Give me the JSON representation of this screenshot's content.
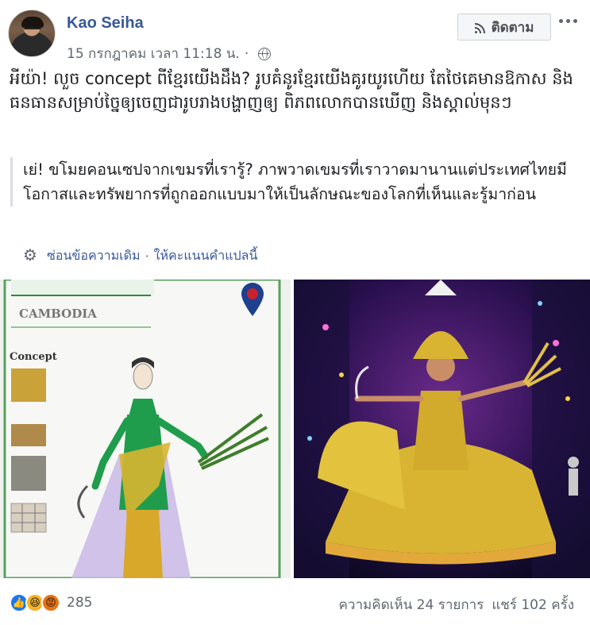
{
  "post": {
    "author": "Kao Seiha",
    "timestamp": "15 กรกฎาคม เวลา 11:18 น.",
    "dot": "·",
    "audience_icon": "globe-icon",
    "follow_label": "ติดตาม",
    "follow_icon": "rss-icon",
    "more_icon": "more-dots-icon",
    "text": "អីយ៉ា! លួច concept ពីខ្មែរយើងដឹង? រូបគំនូរខ្មែរយើងគូរយូរហើយ តែថៃគេមានឱកាស និងធនធានសម្រាប់ច្នៃឲ្យចេញជារូបរាងបង្ហាញឲ្យ ពិភពលោកបានឃើញ និងស្គាល់មុនៗ",
    "translation": "เย่! ขโมยคอนเซปจากเขมรที่เรารู้? ภาพวาดเขมรที่เราวาดมานานแต่ประเทศไทยมีโอกาสและทรัพยากรที่ถูกออกแบบมาให้เป็นลักษณะของโลกที่เห็นและรู้มาก่อน",
    "translation_controls": {
      "hide_original": "ซ่อนข้อความเดิม",
      "separator": "·",
      "rate_translation": "ให้คะแนนคำแปลนี้"
    }
  },
  "images": {
    "left": {
      "header_text": "CAMBODIA",
      "concept_label": "Concept",
      "accent": "#2e8b3a"
    },
    "right": {
      "background": "#0b0d1a",
      "costume_color": "#d9b432"
    }
  },
  "footer": {
    "reactions": [
      "like",
      "haha",
      "angry"
    ],
    "reaction_count": "285",
    "comments": "ความคิดเห็น 24 รายการ",
    "shares": "แชร์ 102 ครั้ง"
  }
}
